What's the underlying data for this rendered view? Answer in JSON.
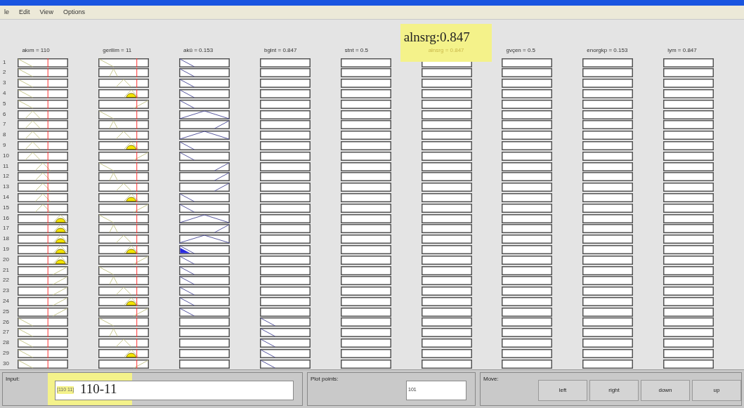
{
  "menu": [
    "le",
    "Edit",
    "View",
    "Options"
  ],
  "columns": [
    {
      "label": "akım = 110",
      "kind": "input"
    },
    {
      "label": "gerilim = 11",
      "kind": "input"
    },
    {
      "label": "akü = 0.153",
      "kind": "output"
    },
    {
      "label": "bglnt = 0.847",
      "kind": "output"
    },
    {
      "label": "stnt = 0.5",
      "kind": "output"
    },
    {
      "label": "alnsrg = 0.847",
      "kind": "output",
      "annotation": "alnsrg:0.847"
    },
    {
      "label": "gvçen = 0.5",
      "kind": "output"
    },
    {
      "label": "enorgkp = 0.153",
      "kind": "output"
    },
    {
      "label": "iym = 0.847",
      "kind": "output"
    }
  ],
  "rows": [
    "1",
    "2",
    "3",
    "4",
    "5",
    "6",
    "7",
    "8",
    "9",
    "10",
    "11",
    "12",
    "13",
    "14",
    "15",
    "16",
    "17",
    "18",
    "19",
    "20",
    "21",
    "22",
    "23",
    "24",
    "25",
    "26",
    "27",
    "28",
    "29",
    "30"
  ],
  "input_panel": {
    "label": "Input:",
    "value": "[110 11]",
    "annotation": "110-11"
  },
  "plot_points": {
    "label": "Plot points:",
    "value": "101"
  },
  "move": {
    "label": "Move:",
    "buttons": [
      "left",
      "right",
      "down",
      "up"
    ]
  }
}
